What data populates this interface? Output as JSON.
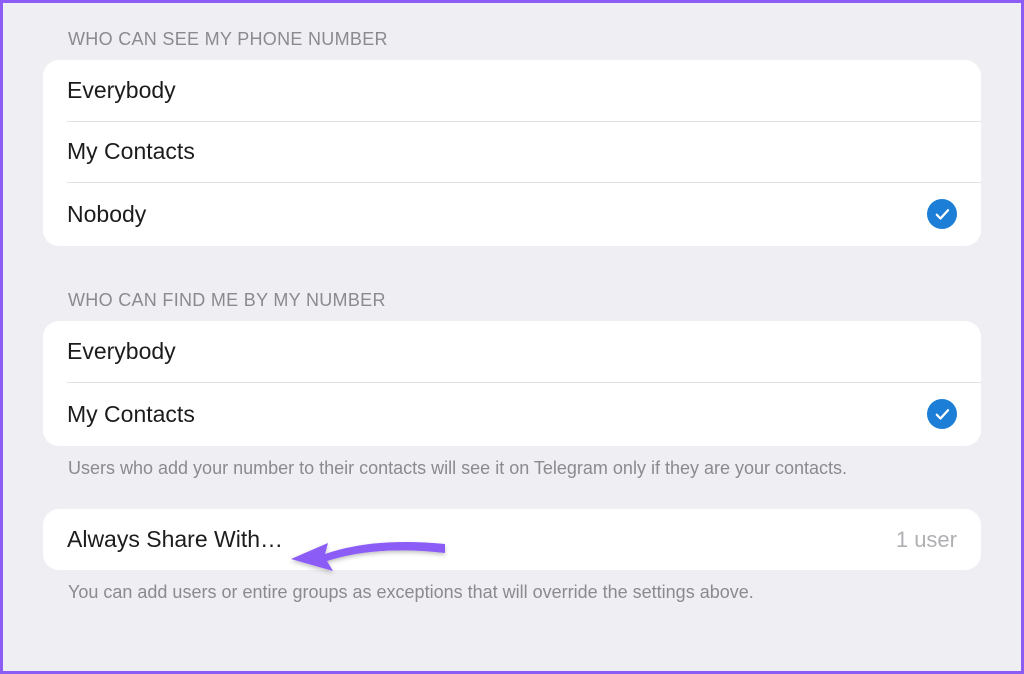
{
  "section1": {
    "header": "WHO CAN SEE MY PHONE NUMBER",
    "options": [
      {
        "label": "Everybody",
        "selected": false
      },
      {
        "label": "My Contacts",
        "selected": false
      },
      {
        "label": "Nobody",
        "selected": true
      }
    ]
  },
  "section2": {
    "header": "WHO CAN FIND ME BY MY NUMBER",
    "options": [
      {
        "label": "Everybody",
        "selected": false
      },
      {
        "label": "My Contacts",
        "selected": true
      }
    ],
    "footer": "Users who add your number to their contacts will see it on Telegram only if they are your contacts."
  },
  "section3": {
    "row": {
      "label": "Always Share With…",
      "detail": "1 user"
    },
    "footer": "You can add users or entire groups as exceptions that will override the settings above."
  },
  "colors": {
    "accent": "#1c7ed6",
    "arrow": "#8b5cf6"
  }
}
